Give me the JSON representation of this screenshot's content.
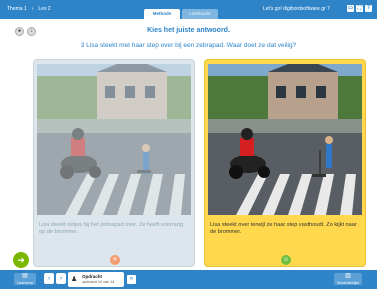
{
  "breadcrumb": {
    "theme": "Thema 1",
    "separator": "›",
    "lesson": "Les 2"
  },
  "tabs": [
    {
      "label": "Methode"
    },
    {
      "label": "Leerkracht"
    }
  ],
  "brand": "Let's go! digibordsoftware gr 7",
  "top_icons": [
    "window-icon",
    "fullscreen-icon",
    "help-icon"
  ],
  "heading": "Kies het juiste antwoord.",
  "question": "3 Lisa steekt met haar step over bij een zebrapad. Waar doet ze dat veilig?",
  "answers": [
    {
      "caption": "Lisa steekt netjes bij het zebrapad over. Ze heeft voorrang op de brommer.",
      "state": "wrong",
      "mark": "✕"
    },
    {
      "caption": "Lisa steekt over terwijl ze haar step vasthoudt. Zo kijkt naar de brommer.",
      "state": "correct",
      "mark": "☺"
    }
  ],
  "next_label": "verder",
  "bottom": {
    "left_button": "Lesmenu",
    "opdracht_title": "Opdracht",
    "opdracht_sub": "opdracht 10 van 14",
    "right_button": "Woordenlijst"
  },
  "colors": {
    "brand_blue": "#2f84c8",
    "correct_yellow": "#ffd84d",
    "wrong_orange": "#f39a6e",
    "ok_green": "#6fbf3e"
  }
}
